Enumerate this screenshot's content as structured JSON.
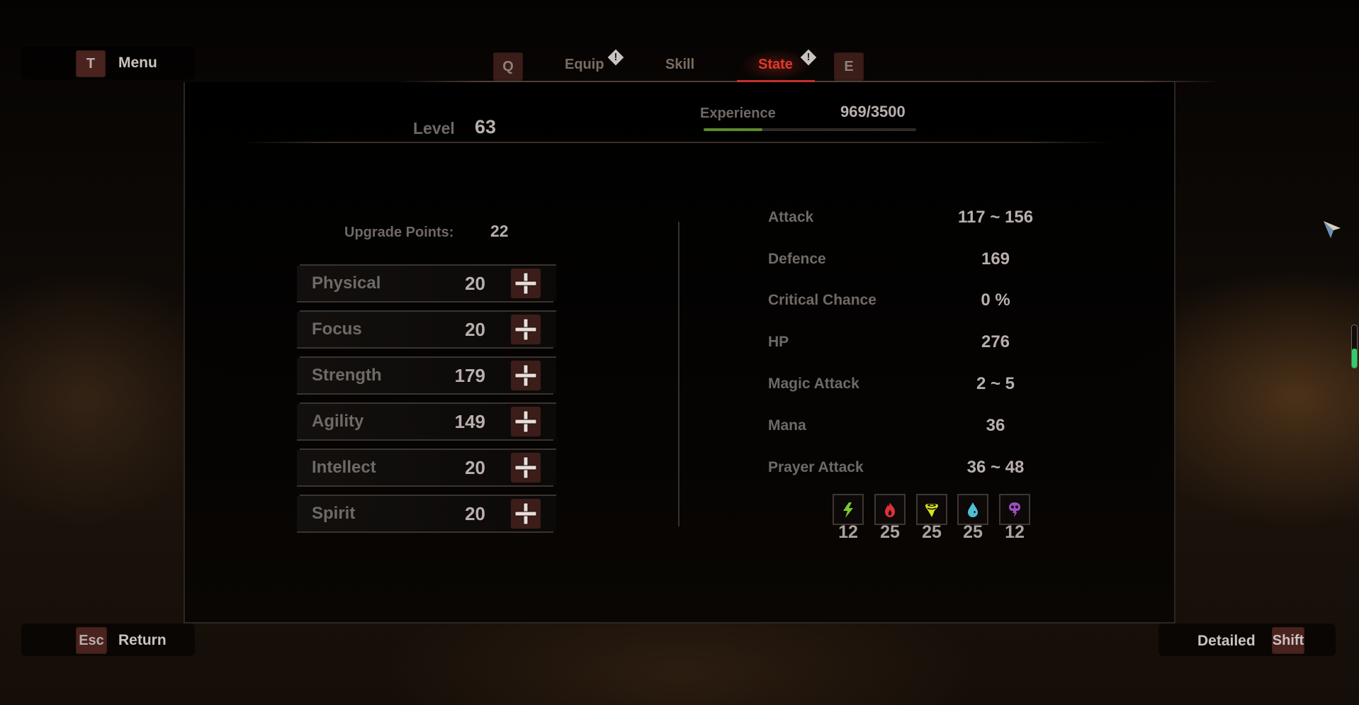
{
  "top_hints": {
    "menu": {
      "key": "T",
      "label": "Menu"
    }
  },
  "tabs": {
    "prev_key": "Q",
    "next_key": "E",
    "items": [
      {
        "label": "Equip",
        "alert": true,
        "alert_glyph": "!",
        "active": false
      },
      {
        "label": "Skill",
        "alert": false,
        "active": false
      },
      {
        "label": "State",
        "alert": true,
        "alert_glyph": "!",
        "active": true
      }
    ],
    "active_color": "#e2392c"
  },
  "header": {
    "level_label": "Level",
    "level_value": "63",
    "experience_label": "Experience",
    "experience_value": "969/3500",
    "experience_current": 969,
    "experience_max": 3500,
    "experience_bar_color": "#5f8a2a"
  },
  "upgrade": {
    "label": "Upgrade Points:",
    "value": "22"
  },
  "stats": [
    {
      "name": "Physical",
      "value": "20",
      "plus_icon": "plus-icon"
    },
    {
      "name": "Focus",
      "value": "20",
      "plus_icon": "plus-icon"
    },
    {
      "name": "Strength",
      "value": "179",
      "plus_icon": "plus-icon"
    },
    {
      "name": "Agility",
      "value": "149",
      "plus_icon": "plus-icon"
    },
    {
      "name": "Intellect",
      "value": "20",
      "plus_icon": "plus-icon"
    },
    {
      "name": "Spirit",
      "value": "20",
      "plus_icon": "plus-icon"
    }
  ],
  "attributes": [
    {
      "label": "Attack",
      "value": "117 ~ 156"
    },
    {
      "label": "Defence",
      "value": "169"
    },
    {
      "label": "Critical Chance",
      "value": "0 %"
    },
    {
      "label": "HP",
      "value": "276"
    },
    {
      "label": "Magic Attack",
      "value": "2 ~ 5"
    },
    {
      "label": "Mana",
      "value": "36"
    },
    {
      "label": "Prayer Attack",
      "value": "36 ~ 48"
    }
  ],
  "resistances": [
    {
      "icon": "lightning-icon",
      "value": "12",
      "color": "#7cc832"
    },
    {
      "icon": "fire-icon",
      "value": "25",
      "color": "#e0303a"
    },
    {
      "icon": "wind-icon",
      "value": "25",
      "color": "#d6e020"
    },
    {
      "icon": "water-drop-icon",
      "value": "25",
      "color": "#4ec0d6"
    },
    {
      "icon": "poison-skull-icon",
      "value": "12",
      "color": "#9b4fc0"
    }
  ],
  "bottom_hints": {
    "return": {
      "key": "Esc",
      "label": "Return"
    },
    "detailed": {
      "key": "Shift",
      "label": "Detailed"
    }
  },
  "side_gauge": {
    "fill_fraction": 0.45,
    "color": "#2fcf6a"
  }
}
